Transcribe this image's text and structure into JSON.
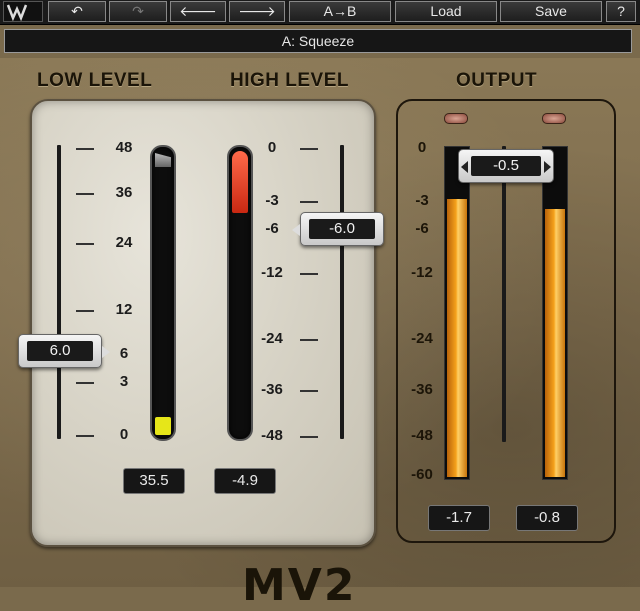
{
  "toolbar": {
    "undo_icon": "undo-icon",
    "redo_icon": "redo-icon",
    "prev_icon": "arrow-left-icon",
    "next_icon": "arrow-right-icon",
    "ab_label": "A→B",
    "load_label": "Load",
    "save_label": "Save",
    "help_label": "?"
  },
  "preset": {
    "name": "A: Squeeze"
  },
  "sections": {
    "low": "LOW LEVEL",
    "high": "HIGH LEVEL",
    "output": "OUTPUT"
  },
  "low_level": {
    "scale": [
      "48",
      "36",
      "24",
      "12",
      "6",
      "3",
      "0"
    ],
    "slider_value": "6.0",
    "readout": "35.5"
  },
  "high_level": {
    "scale": [
      "0",
      "-3",
      "-6",
      "-12",
      "-24",
      "-36",
      "-48"
    ],
    "slider_value": "-6.0",
    "readout": "-4.9"
  },
  "output": {
    "scale": [
      "0",
      "-3",
      "-6",
      "-12",
      "-24",
      "-36",
      "-48",
      "-60"
    ],
    "slider_value": "-0.5",
    "readout_left": "-1.7",
    "readout_right": "-0.8"
  },
  "brand": "MV2",
  "colors": {
    "meter_red": "#e03a20",
    "meter_yellow": "#e6e619",
    "meter_orange": "#f5a21b"
  }
}
